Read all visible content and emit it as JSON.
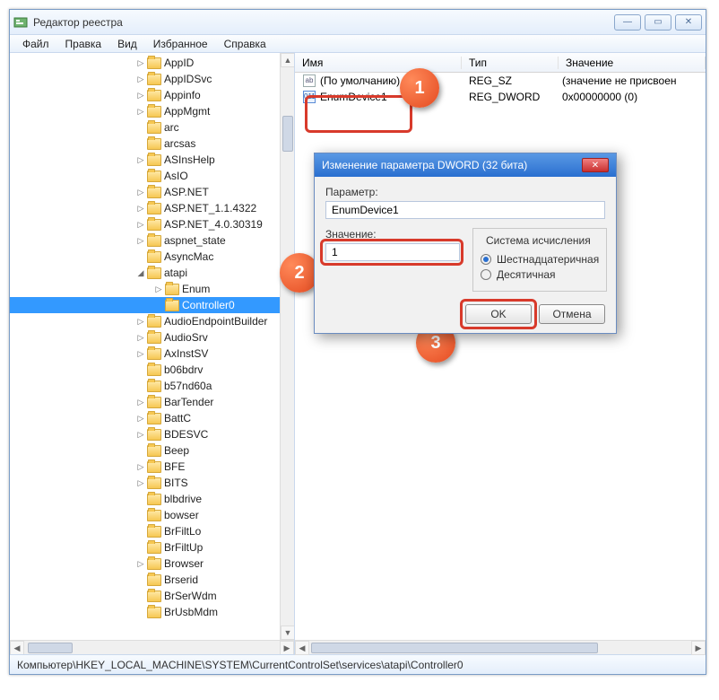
{
  "window": {
    "title": "Редактор реестра"
  },
  "menu": [
    "Файл",
    "Правка",
    "Вид",
    "Избранное",
    "Справка"
  ],
  "tree": {
    "items": [
      {
        "indent": 140,
        "caret": "▷",
        "label": "AppID"
      },
      {
        "indent": 140,
        "caret": "▷",
        "label": "AppIDSvc"
      },
      {
        "indent": 140,
        "caret": "▷",
        "label": "Appinfo"
      },
      {
        "indent": 140,
        "caret": "▷",
        "label": "AppMgmt"
      },
      {
        "indent": 140,
        "caret": "",
        "label": "arc"
      },
      {
        "indent": 140,
        "caret": "",
        "label": "arcsas"
      },
      {
        "indent": 140,
        "caret": "▷",
        "label": "ASInsHelp"
      },
      {
        "indent": 140,
        "caret": "",
        "label": "AsIO"
      },
      {
        "indent": 140,
        "caret": "▷",
        "label": "ASP.NET"
      },
      {
        "indent": 140,
        "caret": "▷",
        "label": "ASP.NET_1.1.4322"
      },
      {
        "indent": 140,
        "caret": "▷",
        "label": "ASP.NET_4.0.30319"
      },
      {
        "indent": 140,
        "caret": "▷",
        "label": "aspnet_state"
      },
      {
        "indent": 140,
        "caret": "",
        "label": "AsyncMac"
      },
      {
        "indent": 140,
        "caret": "◢",
        "label": "atapi"
      },
      {
        "indent": 160,
        "caret": "▷",
        "label": "Enum"
      },
      {
        "indent": 160,
        "caret": "",
        "label": "Controller0",
        "selected": true
      },
      {
        "indent": 140,
        "caret": "▷",
        "label": "AudioEndpointBuilder"
      },
      {
        "indent": 140,
        "caret": "▷",
        "label": "AudioSrv"
      },
      {
        "indent": 140,
        "caret": "▷",
        "label": "AxInstSV"
      },
      {
        "indent": 140,
        "caret": "",
        "label": "b06bdrv"
      },
      {
        "indent": 140,
        "caret": "",
        "label": "b57nd60a"
      },
      {
        "indent": 140,
        "caret": "▷",
        "label": "BarTender"
      },
      {
        "indent": 140,
        "caret": "▷",
        "label": "BattC"
      },
      {
        "indent": 140,
        "caret": "▷",
        "label": "BDESVC"
      },
      {
        "indent": 140,
        "caret": "",
        "label": "Beep"
      },
      {
        "indent": 140,
        "caret": "▷",
        "label": "BFE"
      },
      {
        "indent": 140,
        "caret": "▷",
        "label": "BITS"
      },
      {
        "indent": 140,
        "caret": "",
        "label": "blbdrive"
      },
      {
        "indent": 140,
        "caret": "",
        "label": "bowser"
      },
      {
        "indent": 140,
        "caret": "",
        "label": "BrFiltLo"
      },
      {
        "indent": 140,
        "caret": "",
        "label": "BrFiltUp"
      },
      {
        "indent": 140,
        "caret": "▷",
        "label": "Browser"
      },
      {
        "indent": 140,
        "caret": "",
        "label": "Brserid"
      },
      {
        "indent": 140,
        "caret": "",
        "label": "BrSerWdm"
      },
      {
        "indent": 140,
        "caret": "",
        "label": "BrUsbMdm"
      }
    ]
  },
  "columns": {
    "name": "Имя",
    "type": "Тип",
    "value": "Значение"
  },
  "rows": [
    {
      "icon": "sz",
      "name": "(По умолчанию)",
      "type": "REG_SZ",
      "value": "(значение не присвоен"
    },
    {
      "icon": "dw",
      "name": "EnumDevice1",
      "type": "REG_DWORD",
      "value": "0x00000000 (0)"
    }
  ],
  "dialog": {
    "title": "Изменение параметра DWORD (32 бита)",
    "param_label": "Параметр:",
    "param_value": "EnumDevice1",
    "value_label": "Значение:",
    "value_input": "1",
    "base_legend": "Система исчисления",
    "radio_hex": "Шестнадцатеричная",
    "radio_dec": "Десятичная",
    "ok": "OK",
    "cancel": "Отмена"
  },
  "steps": {
    "s1": "1",
    "s2": "2",
    "s3": "3"
  },
  "statusbar": "Компьютер\\HKEY_LOCAL_MACHINE\\SYSTEM\\CurrentControlSet\\services\\atapi\\Controller0"
}
